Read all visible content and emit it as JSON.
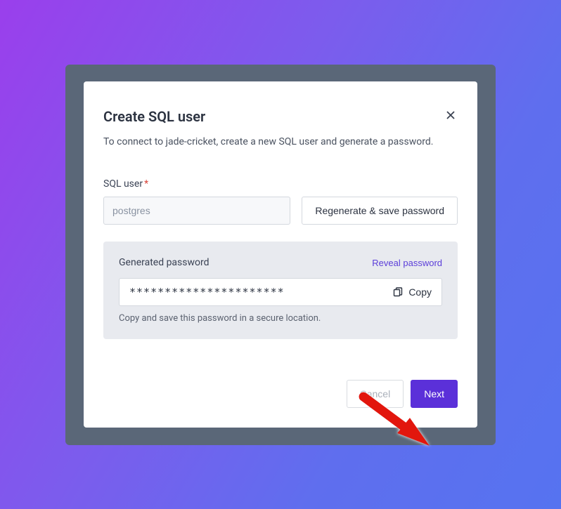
{
  "modal": {
    "title": "Create SQL user",
    "subtitle": "To connect to jade-cricket, create a new SQL user and generate a password."
  },
  "form": {
    "user_label": "SQL user",
    "user_required": "*",
    "user_placeholder": "postgres",
    "regen_label": "Regenerate & save password"
  },
  "password_panel": {
    "label": "Generated password",
    "reveal_label": "Reveal password",
    "masked_value": "**********************",
    "copy_label": "Copy",
    "hint": "Copy and save this password in a secure location."
  },
  "footer": {
    "cancel_label": "Cancel",
    "next_label": "Next"
  }
}
